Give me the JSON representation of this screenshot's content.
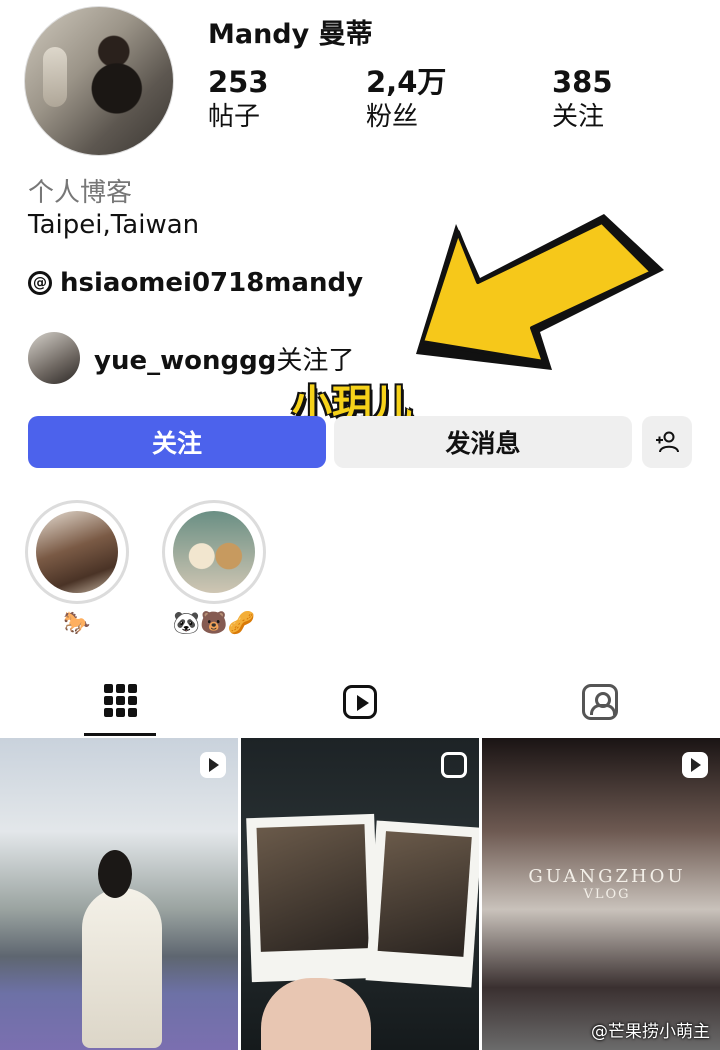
{
  "profile": {
    "username": "Mandy 曼蒂",
    "stats": [
      {
        "value": "253",
        "label": "帖子"
      },
      {
        "value": "2,4万",
        "label": "粉丝"
      },
      {
        "value": "385",
        "label": "关注"
      }
    ],
    "category": "个人博客",
    "location": "Taipei,Taiwan",
    "threads_handle": "hsiaomei0718mandy",
    "followed_by_user": "yue_wonggg",
    "followed_by_suffix": "关注了"
  },
  "overlay": {
    "name_text": "小玥儿",
    "arrow_color": "#f6c81a"
  },
  "actions": {
    "follow_label": "关注",
    "message_label": "发消息",
    "add_person_icon": "add-person-icon"
  },
  "highlights": [
    {
      "caption": "🐎"
    },
    {
      "caption": "🐼🐻🥜"
    }
  ],
  "tabs": {
    "grid_icon": "grid-icon",
    "reels_icon": "reels-icon",
    "tagged_icon": "tagged-icon"
  },
  "posts": [
    {
      "badge": "reel"
    },
    {
      "badge": "carousel"
    },
    {
      "badge": "reel",
      "overlay_lines": [
        "GUANGZHOU",
        "VLOG"
      ]
    }
  ],
  "credit": "@芒果捞小萌主",
  "colors": {
    "accent": "#4c62ec",
    "secondary_button": "#efefef"
  }
}
